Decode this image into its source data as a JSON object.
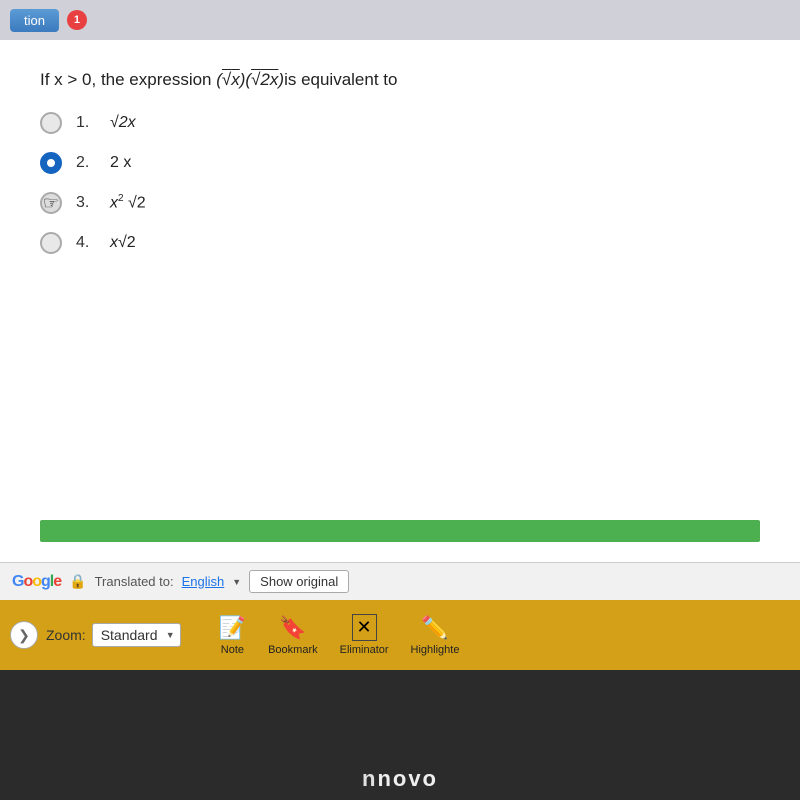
{
  "browser": {
    "nav_button_label": "tion",
    "notification_count": "1"
  },
  "question": {
    "text_prefix": "If x > 0, the expression ",
    "expression": "(√x)(√2x)",
    "text_suffix": "is equivalent to",
    "options": [
      {
        "id": 1,
        "number": "1.",
        "math": "√2x",
        "selected": false,
        "cursor": false
      },
      {
        "id": 2,
        "number": "2.",
        "math": "2 x",
        "selected": true,
        "cursor": false
      },
      {
        "id": 3,
        "number": "3.",
        "math": "x² √2",
        "selected": false,
        "cursor": true
      },
      {
        "id": 4,
        "number": "4.",
        "math": "x√2",
        "selected": false,
        "cursor": false
      }
    ]
  },
  "translate_bar": {
    "logo": "Google",
    "translated_label": "Translated to:",
    "language": "English",
    "show_original": "Show original"
  },
  "toolbar": {
    "zoom_label": "Zoom:",
    "zoom_value": "Standard",
    "tools": [
      {
        "id": "note",
        "icon": "📝",
        "label": "Note"
      },
      {
        "id": "bookmark",
        "icon": "🔖",
        "label": "Bookmark"
      },
      {
        "id": "eliminator",
        "icon": "✖",
        "label": "Eliminator"
      },
      {
        "id": "highlighter",
        "icon": "✏️",
        "label": "Highlighte"
      }
    ]
  },
  "laptop": {
    "brand": "novo"
  }
}
